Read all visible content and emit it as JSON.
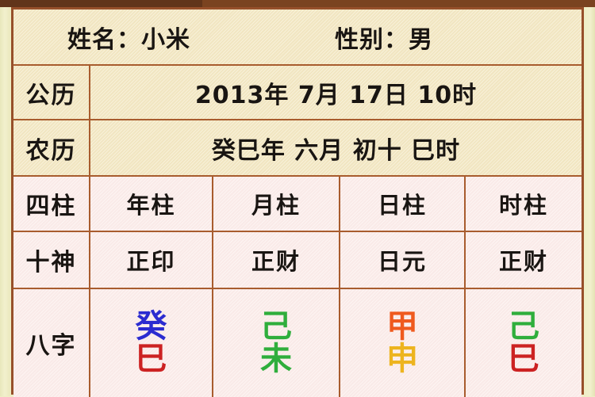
{
  "theme": {
    "page_background": "#efeec6",
    "top_bar_color": "#61351a",
    "table_border": "#97502a",
    "cell_border": "#a85c2e",
    "beige_row_bg": "#f5ebc9",
    "pink_row_bg": "#fceeec",
    "text_color": "#191512"
  },
  "header": {
    "name_label": "姓名：小米",
    "gender_label": "性别：男"
  },
  "rows": {
    "solar": {
      "label": "公历",
      "value": "2013年 7月 17日 10时"
    },
    "lunar": {
      "label": "农历",
      "value": "癸巳年 六月 初十 巳时"
    },
    "pillars": {
      "label": "四柱",
      "cells": [
        "年柱",
        "月柱",
        "日柱",
        "时柱"
      ]
    },
    "ten_gods": {
      "label": "十神",
      "cells": [
        "正印",
        "正财",
        "日元",
        "正财"
      ]
    },
    "bazi": {
      "label": "八字",
      "columns": [
        {
          "stem": "癸",
          "stem_color": "#2b2bd0",
          "branch": "巳",
          "branch_color": "#cc2222"
        },
        {
          "stem": "己",
          "stem_color": "#2fae3c",
          "branch": "未",
          "branch_color": "#2fae3c"
        },
        {
          "stem": "甲",
          "stem_color": "#ef5a1e",
          "branch": "申",
          "branch_color": "#edb41f"
        },
        {
          "stem": "己",
          "stem_color": "#2fae3c",
          "branch": "巳",
          "branch_color": "#cc2222"
        }
      ]
    }
  }
}
